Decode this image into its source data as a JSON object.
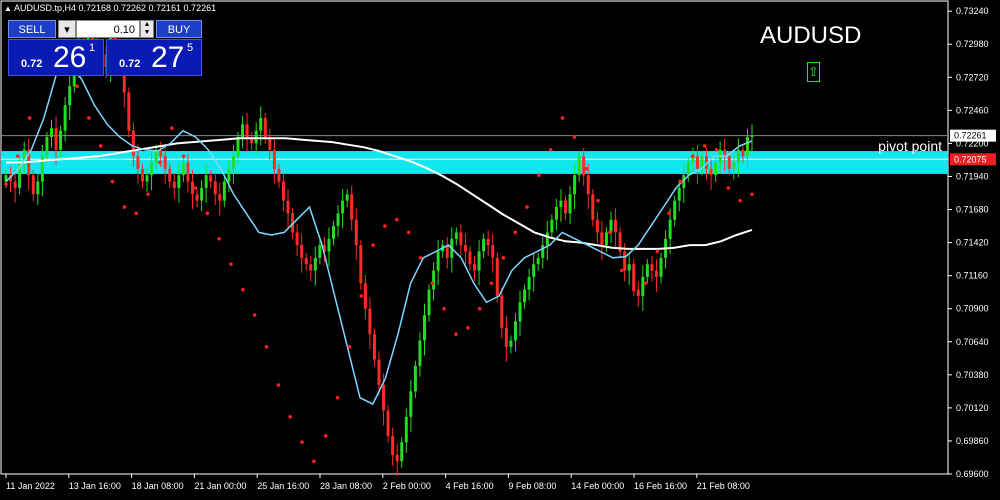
{
  "header": {
    "symbol_line": "AUDUSD.tp,H4  0.72168 0.72262 0.72161 0.72261"
  },
  "trade_panel": {
    "sell_label": "SELL",
    "buy_label": "BUY",
    "lot_value": "0.10",
    "sell_small": "0.72",
    "sell_big": "26",
    "sell_sup": "1",
    "buy_small": "0.72",
    "buy_big": "27",
    "buy_sup": "5"
  },
  "symbol_title": "AUDUSD",
  "pivot_label": "pivot point",
  "colors": {
    "background": "#000000",
    "bull_candle": "#22dd22",
    "bear_candle": "#ff2a2a",
    "ma_fast": "#7fd7ff",
    "ma_slow": "#ffffff",
    "sar": "#ff1f1f",
    "zone": "#12e6ee",
    "accent_up": "#2ee62e"
  },
  "icons": {
    "up_arrow": "up-arrow-icon"
  },
  "chart_data": {
    "type": "candlestick",
    "ylim": [
      0.696,
      0.7332
    ],
    "y_ticks": [
      "0.73240",
      "0.72980",
      "0.72720",
      "0.72460",
      "0.72200",
      "0.71940",
      "0.71680",
      "0.71420",
      "0.71160",
      "0.70900",
      "0.70640",
      "0.70380",
      "0.70120",
      "0.69860",
      "0.69600"
    ],
    "x_ticks": [
      "11 Jan 2022",
      "13 Jan 16:00",
      "18 Jan 08:00",
      "21 Jan 00:00",
      "25 Jan 16:00",
      "28 Jan 08:00",
      "2 Feb 00:00",
      "4 Feb 16:00",
      "9 Feb 08:00",
      "14 Feb 00:00",
      "16 Feb 16:00",
      "21 Feb 08:00"
    ],
    "current_price": 0.72261,
    "current_price_label": "0.72261",
    "pivot_point": 0.72075,
    "pivot_point_label": "0.72075",
    "zone": [
      0.7196,
      0.7214
    ],
    "closes": [
      0.7195,
      0.719,
      0.7185,
      0.7205,
      0.7215,
      0.7195,
      0.718,
      0.719,
      0.721,
      0.7225,
      0.7232,
      0.7215,
      0.723,
      0.725,
      0.7265,
      0.728,
      0.73,
      0.7295,
      0.7305,
      0.73,
      0.7285,
      0.729,
      0.728,
      0.7305,
      0.729,
      0.7285,
      0.726,
      0.723,
      0.721,
      0.72,
      0.719,
      0.7195,
      0.7205,
      0.7215,
      0.721,
      0.72,
      0.719,
      0.7185,
      0.7195,
      0.7205,
      0.719,
      0.718,
      0.7175,
      0.7185,
      0.7195,
      0.719,
      0.718,
      0.7175,
      0.719,
      0.72,
      0.721,
      0.7225,
      0.7235,
      0.7225,
      0.722,
      0.723,
      0.724,
      0.7225,
      0.7215,
      0.72,
      0.719,
      0.7175,
      0.7165,
      0.715,
      0.714,
      0.713,
      0.7125,
      0.712,
      0.713,
      0.714,
      0.7135,
      0.7145,
      0.7155,
      0.7165,
      0.7175,
      0.718,
      0.716,
      0.714,
      0.711,
      0.709,
      0.707,
      0.705,
      0.703,
      0.701,
      0.699,
      0.6975,
      0.697,
      0.6985,
      0.7005,
      0.7025,
      0.7045,
      0.7065,
      0.7085,
      0.7105,
      0.712,
      0.7135,
      0.714,
      0.713,
      0.7145,
      0.715,
      0.714,
      0.7135,
      0.7125,
      0.712,
      0.7135,
      0.7145,
      0.714,
      0.713,
      0.71,
      0.7075,
      0.706,
      0.7065,
      0.708,
      0.7095,
      0.7105,
      0.7115,
      0.7125,
      0.713,
      0.714,
      0.715,
      0.716,
      0.717,
      0.7175,
      0.7165,
      0.718,
      0.7195,
      0.721,
      0.7195,
      0.718,
      0.716,
      0.715,
      0.714,
      0.715,
      0.716,
      0.715,
      0.7135,
      0.712,
      0.7125,
      0.7105,
      0.71,
      0.7115,
      0.7125,
      0.712,
      0.7115,
      0.713,
      0.7145,
      0.716,
      0.7175,
      0.7185,
      0.7195,
      0.7205,
      0.721,
      0.72,
      0.721,
      0.72,
      0.7195,
      0.7205,
      0.7215,
      0.721,
      0.72,
      0.7205,
      0.7215,
      0.721,
      0.7225,
      0.7226
    ],
    "ma_slow": [
      0.7205,
      0.7205,
      0.7206,
      0.7207,
      0.7208,
      0.7209,
      0.721,
      0.7212,
      0.7214,
      0.7216,
      0.7218,
      0.722,
      0.7221,
      0.7222,
      0.7223,
      0.7224,
      0.7224,
      0.7224,
      0.7224,
      0.7223,
      0.7222,
      0.7221,
      0.7219,
      0.7217,
      0.7214,
      0.721,
      0.7206,
      0.7201,
      0.7195,
      0.7188,
      0.718,
      0.7172,
      0.7164,
      0.7157,
      0.715,
      0.7146,
      0.7143,
      0.7142,
      0.714,
      0.7138,
      0.7137,
      0.7137,
      0.7137,
      0.7138,
      0.714,
      0.714,
      0.7143,
      0.7148,
      0.7152
    ],
    "ma_fast": [
      0.719,
      0.72,
      0.7215,
      0.724,
      0.7275,
      0.7285,
      0.727,
      0.725,
      0.7235,
      0.7225,
      0.7218,
      0.7215,
      0.7214,
      0.722,
      0.723,
      0.7225,
      0.7215,
      0.72,
      0.718,
      0.7165,
      0.715,
      0.7148,
      0.715,
      0.716,
      0.717,
      0.714,
      0.71,
      0.706,
      0.702,
      0.7015,
      0.7035,
      0.707,
      0.711,
      0.713,
      0.7135,
      0.714,
      0.713,
      0.711,
      0.7095,
      0.71,
      0.712,
      0.713,
      0.7135,
      0.714,
      0.715,
      0.7145,
      0.714,
      0.7135,
      0.713,
      0.7131,
      0.714,
      0.7155,
      0.717,
      0.7185,
      0.7195,
      0.72,
      0.721,
      0.721,
      0.7218,
      0.7222
    ],
    "sar": [
      0.7188,
      0.721,
      0.724,
      0.7275,
      0.7295,
      0.729,
      0.7265,
      0.724,
      0.7218,
      0.719,
      0.717,
      0.7165,
      0.718,
      0.7205,
      0.7232,
      0.721,
      0.7185,
      0.7165,
      0.7145,
      0.7125,
      0.7105,
      0.7085,
      0.706,
      0.703,
      0.7005,
      0.6985,
      0.697,
      0.699,
      0.702,
      0.706,
      0.71,
      0.714,
      0.7155,
      0.716,
      0.715,
      0.713,
      0.711,
      0.709,
      0.707,
      0.7075,
      0.709,
      0.711,
      0.713,
      0.715,
      0.717,
      0.7195,
      0.7215,
      0.724,
      0.7225,
      0.72,
      0.7175,
      0.715,
      0.712,
      0.7105,
      0.711,
      0.7135,
      0.7165,
      0.719,
      0.721,
      0.7218,
      0.7215,
      0.7185,
      0.7175,
      0.718
    ]
  }
}
